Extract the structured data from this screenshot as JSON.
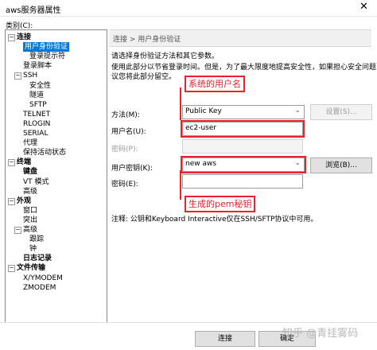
{
  "window": {
    "title": "aws服务器属性",
    "close_glyph": "✕"
  },
  "category_label": "类别(C):",
  "tree": [
    {
      "label": "连接",
      "bold": true,
      "twisty": "−"
    },
    {
      "label": "用户身份验证",
      "selected": true
    },
    {
      "label": "登录提示符"
    },
    {
      "label": "登录脚本"
    },
    {
      "label": "SSH",
      "twisty": "−"
    },
    {
      "label": "安全性"
    },
    {
      "label": "隧道"
    },
    {
      "label": "SFTP"
    },
    {
      "label": "TELNET"
    },
    {
      "label": "RLOGIN"
    },
    {
      "label": "SERIAL"
    },
    {
      "label": "代理"
    },
    {
      "label": "保持活动状态"
    },
    {
      "label": "终端",
      "bold": true,
      "twisty": "−"
    },
    {
      "label": "键盘",
      "bold": true
    },
    {
      "label": "VT 模式"
    },
    {
      "label": "高级"
    },
    {
      "label": "外观",
      "bold": true,
      "twisty": "−"
    },
    {
      "label": "窗口"
    },
    {
      "label": "突出"
    },
    {
      "label": "高级",
      "twisty": "−"
    },
    {
      "label": "跟踪"
    },
    {
      "label": "钟"
    },
    {
      "label": "日志记录",
      "bold": true
    },
    {
      "label": "文件传输",
      "bold": true,
      "twisty": "−"
    },
    {
      "label": "X/YMODEM"
    },
    {
      "label": "ZMODEM"
    }
  ],
  "panel": {
    "breadcrumb": "连接 > 用户身份验证",
    "intro1": "请选择身份验证方法和其它参数。",
    "intro2a": "使用此部分以节省登录时间。但是，为了最大限度地提高安全性，如果担心安全问题，建",
    "intro2b": "议您将此部分留空。",
    "method_label": "方法(M):",
    "method_value": "Public Key",
    "settings_button": "设置(S)...",
    "username_label": "用户名(U):",
    "username_value": "ec2-user",
    "password_label": "密码(P):",
    "user_key_label": "用户密钥(K):",
    "user_key_value": "new aws",
    "browse_button": "浏览(B)...",
    "passphrase_label": "密码(E):",
    "note": "注释: 公钥和Keyboard Interactive仅在SSH/SFTP协议中可用。"
  },
  "annotations": {
    "username_note": "系统的用户名",
    "pem_note": "生成的pem秘钥"
  },
  "footer": {
    "connect_button": "连接",
    "ok_button": "确定"
  },
  "watermark": "知乎 @青挂雾码",
  "colors": {
    "accent": "#0078d7",
    "annotation": "#e8232b"
  }
}
